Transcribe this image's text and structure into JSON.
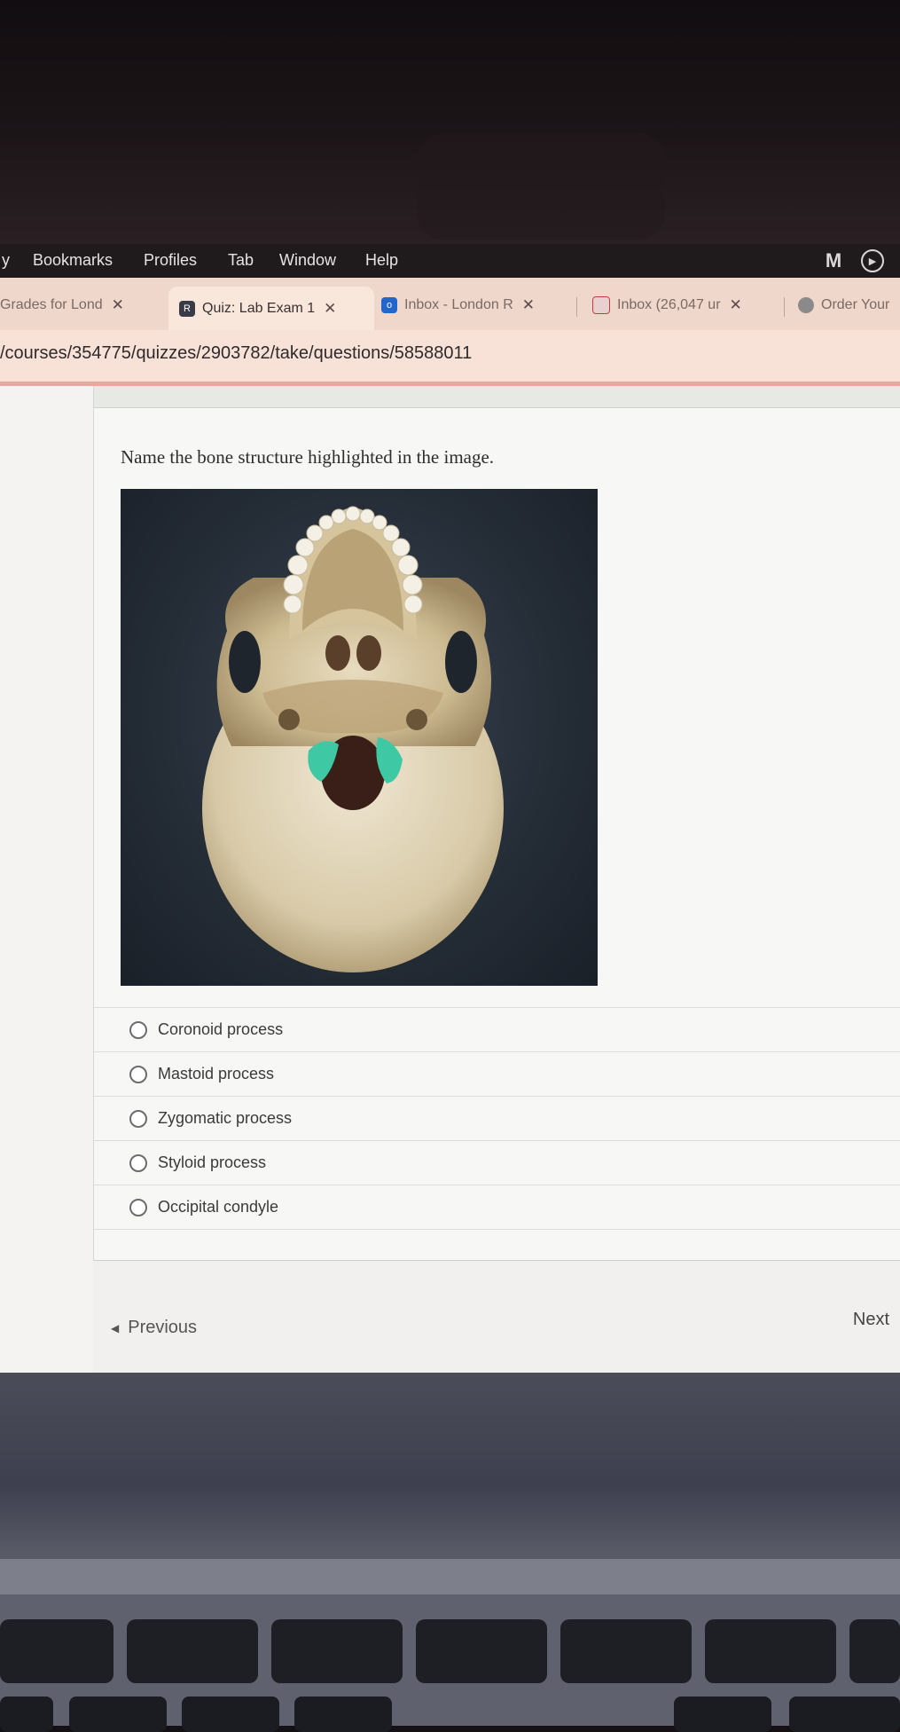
{
  "menubar": {
    "items": [
      "y",
      "Bookmarks",
      "Profiles",
      "Tab",
      "Window",
      "Help"
    ],
    "m_icon": "M"
  },
  "tabs": [
    {
      "label": "Grades for Lond",
      "active": false,
      "favicon_color": "#c04040"
    },
    {
      "label": "Quiz: Lab Exam 1",
      "active": true,
      "favicon_color": "#3a3a48",
      "favicon_letter": "R"
    },
    {
      "label": "Inbox - London R",
      "active": false,
      "favicon_color": "#2266cc",
      "favicon_letter": "o"
    },
    {
      "label": "Inbox (26,047 ur",
      "active": false,
      "favicon_color": "#c04040"
    },
    {
      "label": "Order Your",
      "active": false,
      "favicon_color": "#8a8a8a"
    }
  ],
  "address": {
    "url": "/courses/354775/quizzes/2903782/take/questions/58588011"
  },
  "quiz": {
    "question": "Name the bone structure highlighted in the image.",
    "answers": [
      "Coronoid process",
      "Mastoid process",
      "Zygomatic process",
      "Styloid process",
      "Occipital condyle"
    ],
    "highlight_color": "#3ec9a4"
  },
  "nav": {
    "previous": "Previous",
    "next": "Next"
  }
}
